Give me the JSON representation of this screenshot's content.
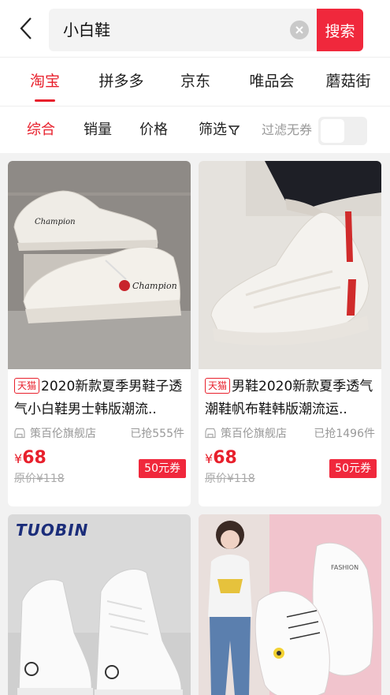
{
  "search": {
    "query": "小白鞋",
    "button_label": "搜索"
  },
  "platforms": [
    "淘宝",
    "拼多多",
    "京东",
    "唯品会",
    "蘑菇街"
  ],
  "sort": {
    "comprehensive": "综合",
    "sales": "销量",
    "price": "价格",
    "filter": "筛选",
    "filter_no_coupon": "过滤无券"
  },
  "products": [
    {
      "badge": "天猫",
      "title": "2020新款夏季男鞋子透气小白鞋男士韩版潮流..",
      "shop": "策百伦旗舰店",
      "sold": "已抢555件",
      "price_symbol": "¥",
      "price": "68",
      "original_price": "原价¥118",
      "coupon": "50元券"
    },
    {
      "badge": "天猫",
      "title": "男鞋2020新款夏季透气潮鞋帆布鞋韩版潮流运..",
      "shop": "策百伦旗舰店",
      "sold": "已抢1496件",
      "price_symbol": "¥",
      "price": "68",
      "original_price": "原价¥118",
      "coupon": "50元券"
    },
    {
      "brand_logo": "TUOBIN"
    },
    {}
  ],
  "colors": {
    "accent": "#e8202c",
    "search_button": "#f0283c"
  }
}
